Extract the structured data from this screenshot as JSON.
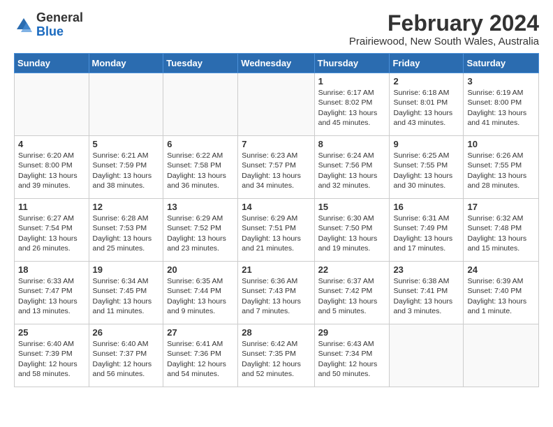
{
  "header": {
    "logo_general": "General",
    "logo_blue": "Blue",
    "month_year": "February 2024",
    "location": "Prairiewood, New South Wales, Australia"
  },
  "days_of_week": [
    "Sunday",
    "Monday",
    "Tuesday",
    "Wednesday",
    "Thursday",
    "Friday",
    "Saturday"
  ],
  "weeks": [
    [
      {
        "day": "",
        "info": ""
      },
      {
        "day": "",
        "info": ""
      },
      {
        "day": "",
        "info": ""
      },
      {
        "day": "",
        "info": ""
      },
      {
        "day": "1",
        "info": "Sunrise: 6:17 AM\nSunset: 8:02 PM\nDaylight: 13 hours\nand 45 minutes."
      },
      {
        "day": "2",
        "info": "Sunrise: 6:18 AM\nSunset: 8:01 PM\nDaylight: 13 hours\nand 43 minutes."
      },
      {
        "day": "3",
        "info": "Sunrise: 6:19 AM\nSunset: 8:00 PM\nDaylight: 13 hours\nand 41 minutes."
      }
    ],
    [
      {
        "day": "4",
        "info": "Sunrise: 6:20 AM\nSunset: 8:00 PM\nDaylight: 13 hours\nand 39 minutes."
      },
      {
        "day": "5",
        "info": "Sunrise: 6:21 AM\nSunset: 7:59 PM\nDaylight: 13 hours\nand 38 minutes."
      },
      {
        "day": "6",
        "info": "Sunrise: 6:22 AM\nSunset: 7:58 PM\nDaylight: 13 hours\nand 36 minutes."
      },
      {
        "day": "7",
        "info": "Sunrise: 6:23 AM\nSunset: 7:57 PM\nDaylight: 13 hours\nand 34 minutes."
      },
      {
        "day": "8",
        "info": "Sunrise: 6:24 AM\nSunset: 7:56 PM\nDaylight: 13 hours\nand 32 minutes."
      },
      {
        "day": "9",
        "info": "Sunrise: 6:25 AM\nSunset: 7:55 PM\nDaylight: 13 hours\nand 30 minutes."
      },
      {
        "day": "10",
        "info": "Sunrise: 6:26 AM\nSunset: 7:55 PM\nDaylight: 13 hours\nand 28 minutes."
      }
    ],
    [
      {
        "day": "11",
        "info": "Sunrise: 6:27 AM\nSunset: 7:54 PM\nDaylight: 13 hours\nand 26 minutes."
      },
      {
        "day": "12",
        "info": "Sunrise: 6:28 AM\nSunset: 7:53 PM\nDaylight: 13 hours\nand 25 minutes."
      },
      {
        "day": "13",
        "info": "Sunrise: 6:29 AM\nSunset: 7:52 PM\nDaylight: 13 hours\nand 23 minutes."
      },
      {
        "day": "14",
        "info": "Sunrise: 6:29 AM\nSunset: 7:51 PM\nDaylight: 13 hours\nand 21 minutes."
      },
      {
        "day": "15",
        "info": "Sunrise: 6:30 AM\nSunset: 7:50 PM\nDaylight: 13 hours\nand 19 minutes."
      },
      {
        "day": "16",
        "info": "Sunrise: 6:31 AM\nSunset: 7:49 PM\nDaylight: 13 hours\nand 17 minutes."
      },
      {
        "day": "17",
        "info": "Sunrise: 6:32 AM\nSunset: 7:48 PM\nDaylight: 13 hours\nand 15 minutes."
      }
    ],
    [
      {
        "day": "18",
        "info": "Sunrise: 6:33 AM\nSunset: 7:47 PM\nDaylight: 13 hours\nand 13 minutes."
      },
      {
        "day": "19",
        "info": "Sunrise: 6:34 AM\nSunset: 7:45 PM\nDaylight: 13 hours\nand 11 minutes."
      },
      {
        "day": "20",
        "info": "Sunrise: 6:35 AM\nSunset: 7:44 PM\nDaylight: 13 hours\nand 9 minutes."
      },
      {
        "day": "21",
        "info": "Sunrise: 6:36 AM\nSunset: 7:43 PM\nDaylight: 13 hours\nand 7 minutes."
      },
      {
        "day": "22",
        "info": "Sunrise: 6:37 AM\nSunset: 7:42 PM\nDaylight: 13 hours\nand 5 minutes."
      },
      {
        "day": "23",
        "info": "Sunrise: 6:38 AM\nSunset: 7:41 PM\nDaylight: 13 hours\nand 3 minutes."
      },
      {
        "day": "24",
        "info": "Sunrise: 6:39 AM\nSunset: 7:40 PM\nDaylight: 13 hours\nand 1 minute."
      }
    ],
    [
      {
        "day": "25",
        "info": "Sunrise: 6:40 AM\nSunset: 7:39 PM\nDaylight: 12 hours\nand 58 minutes."
      },
      {
        "day": "26",
        "info": "Sunrise: 6:40 AM\nSunset: 7:37 PM\nDaylight: 12 hours\nand 56 minutes."
      },
      {
        "day": "27",
        "info": "Sunrise: 6:41 AM\nSunset: 7:36 PM\nDaylight: 12 hours\nand 54 minutes."
      },
      {
        "day": "28",
        "info": "Sunrise: 6:42 AM\nSunset: 7:35 PM\nDaylight: 12 hours\nand 52 minutes."
      },
      {
        "day": "29",
        "info": "Sunrise: 6:43 AM\nSunset: 7:34 PM\nDaylight: 12 hours\nand 50 minutes."
      },
      {
        "day": "",
        "info": ""
      },
      {
        "day": "",
        "info": ""
      }
    ]
  ]
}
